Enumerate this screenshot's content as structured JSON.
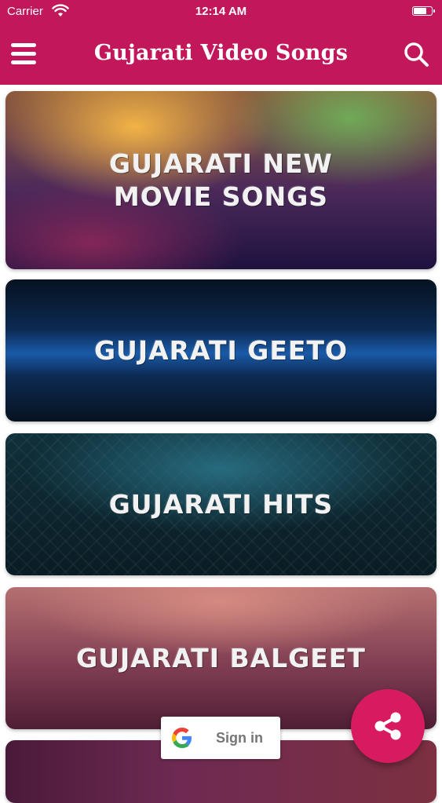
{
  "status_bar": {
    "carrier": "Carrier",
    "time": "12:14 AM",
    "icons": [
      "wifi-icon",
      "battery-icon"
    ]
  },
  "app_bar": {
    "title": "Gujarati Video Songs",
    "color": "#c2185b",
    "icons": [
      "menu-icon",
      "search-icon"
    ]
  },
  "categories": [
    {
      "label": "GUJARATI NEW\nMOVIE SONGS"
    },
    {
      "label": "GUJARATI GEETO"
    },
    {
      "label": "GUJARATI HITS"
    },
    {
      "label": "GUJARATI BALGEET"
    },
    {
      "label": ""
    }
  ],
  "sign_in_button": {
    "label": "Sign in",
    "icon": "google-icon"
  },
  "fab": {
    "icon": "share-icon",
    "color": "#d81b60"
  }
}
